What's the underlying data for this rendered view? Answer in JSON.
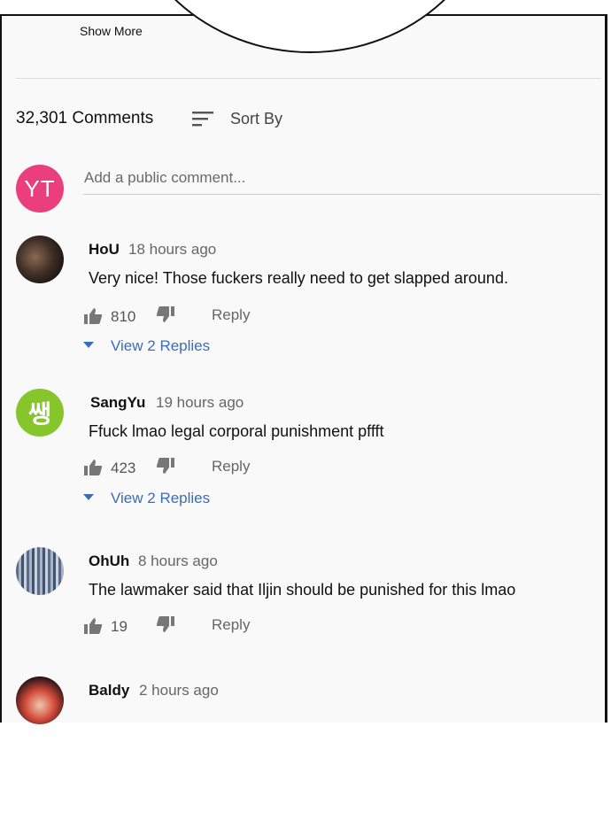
{
  "top": {
    "show_more": "Show More"
  },
  "header": {
    "comments_count": "32,301 Comments",
    "sort_icon": "sort-icon",
    "sort_label": "Sort By"
  },
  "composer": {
    "avatar_text": "YT",
    "avatar_color": "#ea3e7d",
    "placeholder": "Add a public comment..."
  },
  "comments": [
    {
      "author": "HoU",
      "time": "18 hours ago",
      "text": "Very nice! Those fuckers really need to get slapped around.",
      "likes": "810",
      "reply": "Reply",
      "view_replies": "View 2 Replies"
    },
    {
      "author": "SangYu",
      "avatar_text": "쌩",
      "avatar_color": "#86c52c",
      "time": "19 hours ago",
      "text": "Ffuck lmao legal corporal punishment pffft",
      "likes": "423",
      "reply": "Reply",
      "view_replies": "View 2 Replies"
    },
    {
      "author": "OhUh",
      "time": "8 hours ago",
      "text": "The lawmaker said that Iljin should be punished for this lmao",
      "likes": "19",
      "reply": "Reply"
    },
    {
      "author": "Baldy",
      "time": "2 hours ago"
    }
  ],
  "colors": {
    "link": "#3a6db8",
    "background": "#f9f9f9"
  }
}
